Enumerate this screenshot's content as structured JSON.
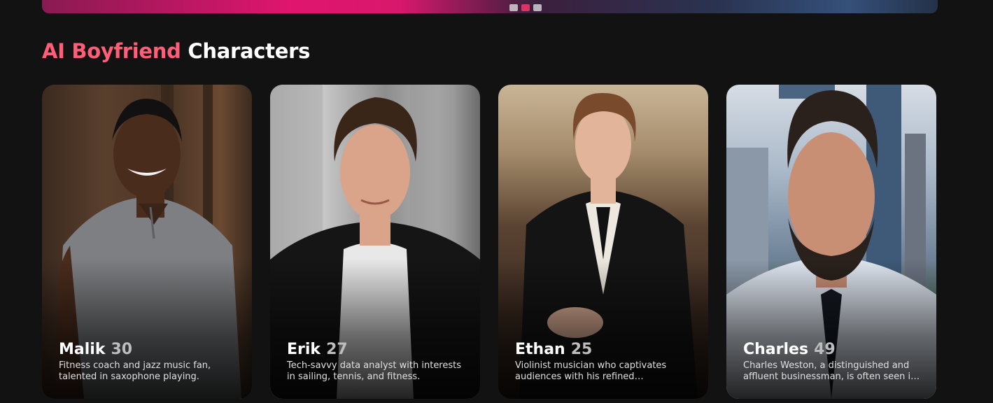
{
  "section": {
    "title_accent": "AI Boyfriend",
    "title_rest": "Characters"
  },
  "cards": [
    {
      "name": "Malik",
      "age": "30",
      "description": "Fitness coach and jazz music fan, talented in saxophone playing.",
      "colors": {
        "skin": "#4a2c1d",
        "hair": "#121010",
        "shirt": "#7d7f82"
      }
    },
    {
      "name": "Erik",
      "age": "27",
      "description": "Tech-savvy data analyst with interests in sailing, tennis, and fitness.",
      "colors": {
        "skin": "#d9a48a",
        "hair": "#3a2618",
        "shirt": "#e8e8e8",
        "jacket": "#151515"
      }
    },
    {
      "name": "Ethan",
      "age": "25",
      "description": "Violinist musician who captivates audiences with his refined performances.",
      "colors": {
        "skin": "#e2b49a",
        "hair": "#7a4a2c",
        "shirt": "#ece8e0",
        "jacket": "#141414"
      }
    },
    {
      "name": "Charles",
      "age": "49",
      "description": "Charles Weston, a distinguished and affluent businessman, is often seen in the city.",
      "colors": {
        "skin": "#c98f75",
        "hair": "#2a211c",
        "shirt": "#dfe6f0",
        "tie": "#151a22"
      }
    }
  ]
}
